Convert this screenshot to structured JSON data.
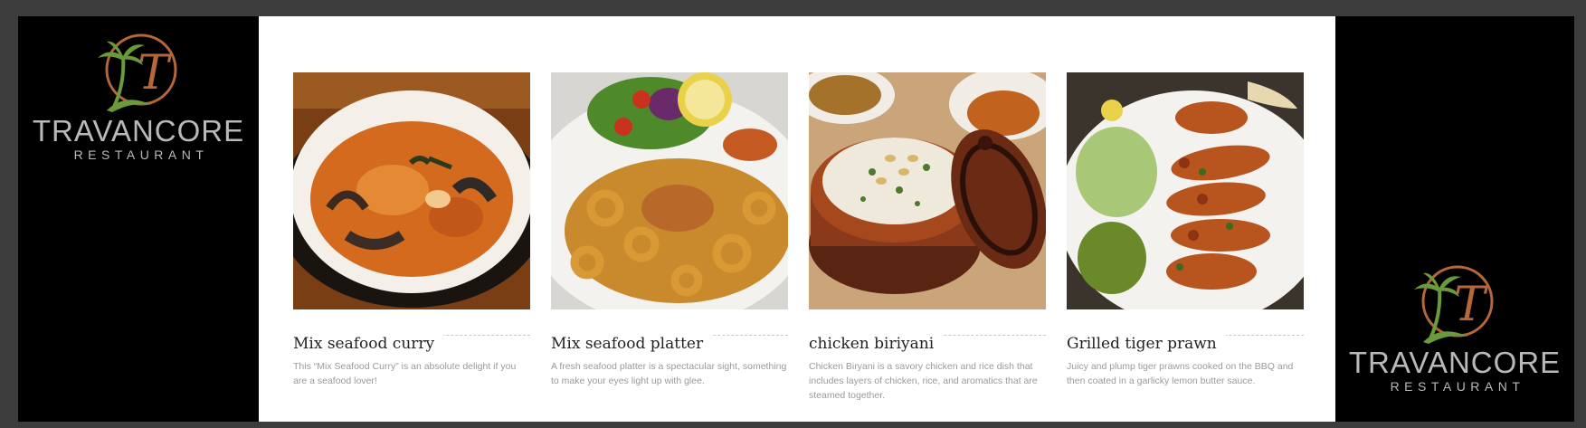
{
  "brand": {
    "name": "TRAVANCORE",
    "tagline": "RESTAURANT",
    "logo_letter": "T",
    "colors": {
      "palm": "#6a9a3a",
      "ring": "#b5673a",
      "text": "#b9b9b9"
    }
  },
  "menu": {
    "items": [
      {
        "title": "Mix seafood curry",
        "description": "This “Mix Seafood Curry” is an absolute delight if you are a seafood lover!"
      },
      {
        "title": "Mix seafood platter",
        "description": "A fresh seafood platter is a spectacular sight, something to make your eyes light up with glee."
      },
      {
        "title": "chicken biriyani",
        "description": "Chicken Biryani is a savory chicken and rice dish that includes layers of chicken, rice, and aromatics that are steamed together."
      },
      {
        "title": "Grilled tiger prawn",
        "description": "Juicy and plump tiger prawns cooked on the BBQ and then coated in a garlicky lemon butter sauce."
      }
    ]
  }
}
